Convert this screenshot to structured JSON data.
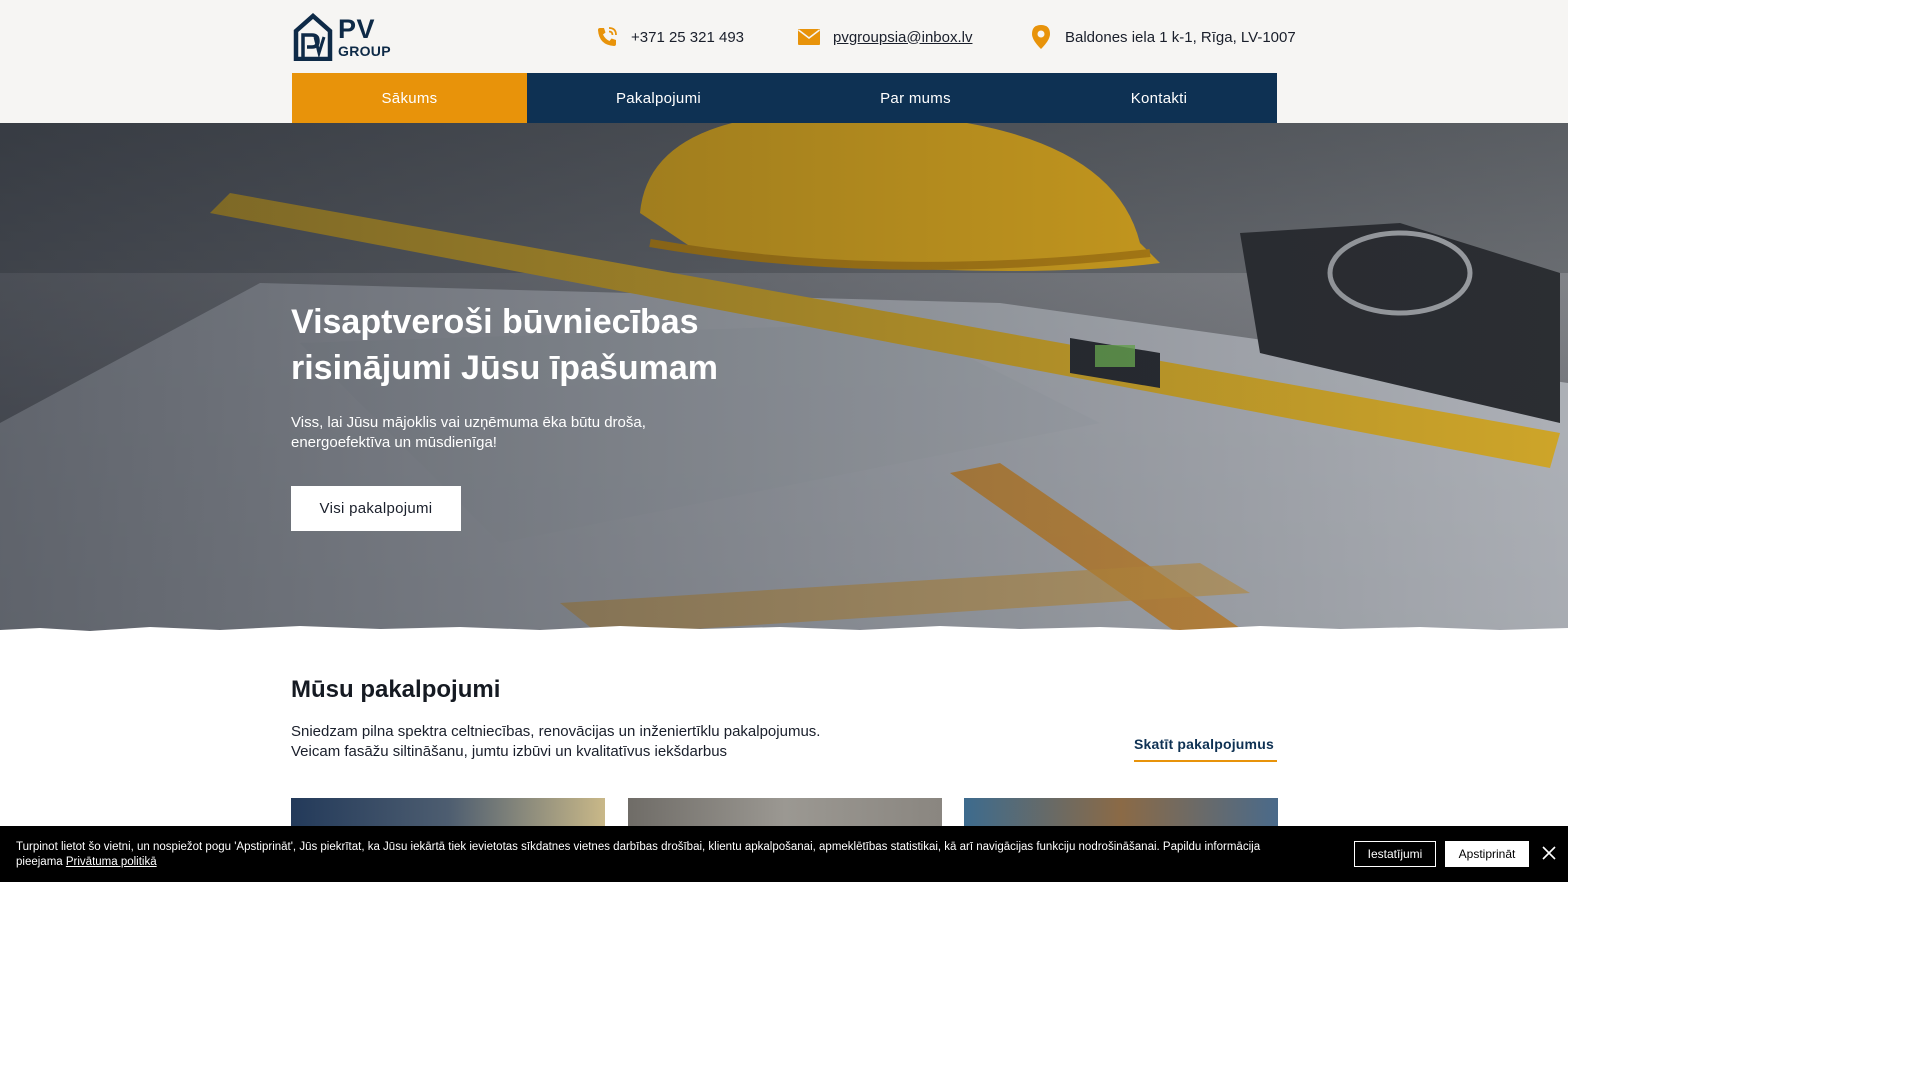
{
  "brand": {
    "logo_line1": "PV",
    "logo_line2": "GROUP",
    "primary_color": "#0e3153",
    "accent_color": "#e8930a"
  },
  "contacts": {
    "phone": "+371 25 321 493",
    "email": "pvgroupsia@inbox.lv",
    "address": "Baldones iela 1 k-1, Rīga, LV-1007",
    "icons": [
      "phone-icon",
      "mail-icon",
      "map-pin-icon"
    ]
  },
  "nav": {
    "items": [
      {
        "label": "Sākums",
        "active": true
      },
      {
        "label": "Pakalpojumi",
        "active": false
      },
      {
        "label": "Par mums",
        "active": false
      },
      {
        "label": "Kontakti",
        "active": false
      }
    ]
  },
  "hero": {
    "title": "Visaptveroši būvniecības risinājumi Jūsu īpašumam",
    "subtitle": "Viss, lai Jūsu mājoklis vai uzņēmuma ēka būtu droša, energoefektīva un mūsdienīga!",
    "button": "Visi pakalpojumi"
  },
  "services": {
    "title": "Mūsu pakalpojumi",
    "description_line1": "Sniedzam pilna spektra celtniecības, renovācijas un inženiertīklu pakalpojumus.",
    "description_line2": "Veicam fasāžu siltināšanu, jumtu izbūvi un kvalitatīvus iekšdarbus",
    "link": "Skatīt pakalpojumus"
  },
  "cookie": {
    "text": "Turpinot lietot šo vietni, un nospiežot pogu 'Apstiprināt', Jūs piekrītat, ka Jūsu iekārtā tiek ievietotas sīkdatnes vietnes darbības drošībai, klientu apkalpošanai, apmeklētības statistikai, kā arī navigācijas funkciju nodrošināšanai. Papildu informācija pieejama",
    "policy_link": "Privātuma politikā",
    "settings_button": "Iestatījumi",
    "accept_button": "Apstiprināt"
  }
}
